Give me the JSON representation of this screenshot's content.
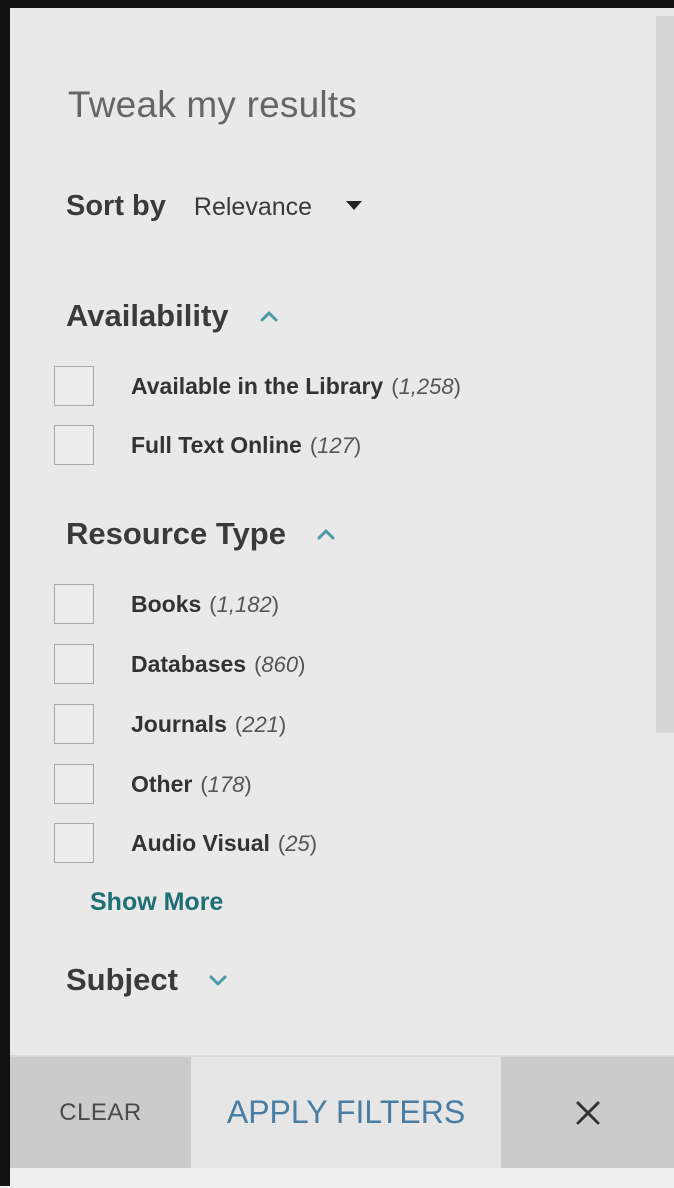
{
  "panel": {
    "title": "Tweak my results"
  },
  "sort": {
    "label": "Sort by",
    "value": "Relevance"
  },
  "sections": {
    "availability": {
      "title": "Availability",
      "items": [
        {
          "label": "Available in the Library",
          "count": "1,258"
        },
        {
          "label": "Full Text Online",
          "count": "127"
        }
      ]
    },
    "resource_type": {
      "title": "Resource Type",
      "items": [
        {
          "label": "Books",
          "count": "1,182"
        },
        {
          "label": "Databases",
          "count": "860"
        },
        {
          "label": "Journals",
          "count": "221"
        },
        {
          "label": "Other",
          "count": "178"
        },
        {
          "label": "Audio Visual",
          "count": "25"
        }
      ],
      "show_more": "Show More"
    },
    "subject": {
      "title": "Subject"
    }
  },
  "footer": {
    "clear": "CLEAR",
    "apply": "APPLY FILTERS"
  },
  "colors": {
    "accent": "#4a9aa8",
    "link": "#1e6f73",
    "apply_text": "#4a7da3"
  },
  "icons": {
    "sort_caret": "caret-down-icon",
    "expand_up": "chevron-up-icon",
    "expand_down": "chevron-down-icon",
    "close": "close-icon"
  }
}
